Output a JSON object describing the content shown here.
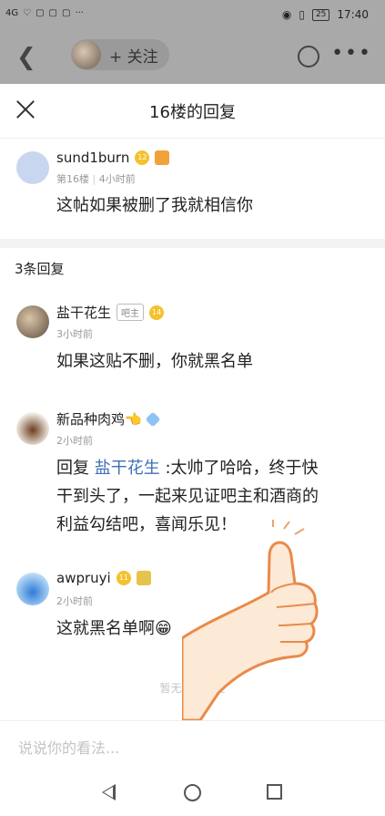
{
  "status_bar": {
    "network": "4G",
    "battery": "25",
    "time": "17:40"
  },
  "nav": {
    "follow_label": "+ 关注"
  },
  "sheet": {
    "title": "16楼的回复",
    "post": {
      "username": "sund1burn",
      "level": "12",
      "floor": "第16楼",
      "time": "4小时前",
      "content": "这帖如果被删了我就相信你"
    },
    "reply_count": "3条回复",
    "replies": [
      {
        "username": "盐干花生",
        "owner_badge": "吧主",
        "level": "14",
        "time": "3小时前",
        "content": "如果这贴不删，你就黑名单"
      },
      {
        "username": "新品种肉鸡👈",
        "level": "8",
        "time": "2小时前",
        "content_prefix": "回复",
        "content_link": "盐干花生",
        "content_line1_rest": " :太帅了哈哈，终于快",
        "content_line2": "干到头了，一起来见证吧主和酒商的",
        "content_line3": "利益勾结吧，喜闻乐见！"
      },
      {
        "username": "awpruyi",
        "level": "11",
        "time": "2小时前",
        "content": "这就黑名单啊😁"
      }
    ],
    "no_more": "暂无更多回复",
    "input_placeholder": "说说你的看法..."
  }
}
